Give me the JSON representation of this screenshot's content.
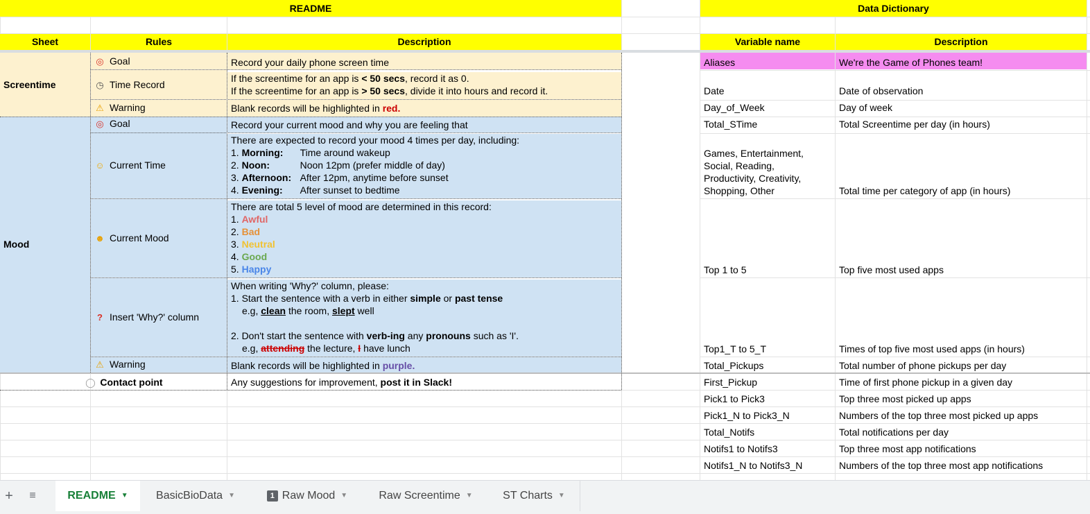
{
  "readme": {
    "title": "README",
    "headers": {
      "sheet": "Sheet",
      "rules": "Rules",
      "description": "Description"
    },
    "screentime": {
      "label": "Screentime",
      "goal": {
        "rule": "Goal",
        "desc": "Record your daily phone screen time"
      },
      "time_record": {
        "rule": "Time Record",
        "line1_a": "If the screentime for an app is ",
        "line1_b": "< 50 secs",
        "line1_c": ", record it as 0.",
        "line2_a": "If the screentime for an app is ",
        "line2_b": "> 50 secs",
        "line2_c": ", divide it into hours and record it."
      },
      "warning": {
        "rule": "Warning",
        "desc_a": "Blank records will be highlighted in ",
        "desc_b": "red."
      }
    },
    "mood": {
      "label": "Mood",
      "goal": {
        "rule": "Goal",
        "desc": "Record your current mood and why you are feeling that"
      },
      "current_time": {
        "rule": "Current Time",
        "intro": "There are expected to record your mood 4 times per day, including:",
        "items": [
          {
            "n": "1. ",
            "name": "Morning:",
            "desc": "Time around wakeup"
          },
          {
            "n": "2. ",
            "name": "Noon:",
            "desc": "Noon 12pm (prefer middle of day)"
          },
          {
            "n": "3. ",
            "name": "Afternoon:",
            "desc": "After 12pm, anytime before sunset"
          },
          {
            "n": "4. ",
            "name": "Evening:",
            "desc": "After sunset to bedtime"
          }
        ]
      },
      "current_mood": {
        "rule": "Current Mood",
        "intro": "There are total 5 level of mood are determined in this record:",
        "levels": [
          "Awful",
          "Bad",
          "Neutral",
          "Good",
          "Happy"
        ],
        "nums": [
          "1. ",
          "2. ",
          "3. ",
          "4. ",
          "5. "
        ]
      },
      "why": {
        "rule": "Insert 'Why?' column",
        "l1": "When writing 'Why?' column, please:",
        "l2_a": "1. Start the sentence with a verb in either ",
        "l2_b": "simple",
        "l2_c": " or ",
        "l2_d": "past tense",
        "l3_a": "e.g, ",
        "l3_b": "clean",
        "l3_c": " the room, ",
        "l3_d": "slept",
        "l3_e": " well",
        "l4_a": "2. Don't start the sentence with ",
        "l4_b": "verb-ing",
        "l4_c": " any ",
        "l4_d": "pronouns",
        "l4_e": " such as 'I'.",
        "l5_a": "e.g, ",
        "l5_b": "attending",
        "l5_c": " the lecture, ",
        "l5_d": "I",
        "l5_e": " have lunch"
      },
      "warning": {
        "rule": "Warning",
        "desc_a": "Blank records will be highlighted in ",
        "desc_b": "purple."
      }
    },
    "contact": {
      "label": "Contact point",
      "desc_a": "Any suggestions for improvement, ",
      "desc_b": "post it in Slack!"
    }
  },
  "dictionary": {
    "title": "Data Dictionary",
    "headers": {
      "variable": "Variable name",
      "description": "Description"
    },
    "rows": [
      {
        "var": "Aliases",
        "desc": "We're the Game of Phones team!"
      },
      {
        "var": "Date",
        "desc": "Date of observation"
      },
      {
        "var": "Day_of_Week",
        "desc": "Day of week"
      },
      {
        "var": "Total_STime",
        "desc": "Total Screentime per day (in hours)"
      },
      {
        "var_lines": [
          "Games, Entertainment,",
          "Social, Reading,",
          "Productivity, Creativity,",
          "Shopping, Other"
        ],
        "desc": "Total time per category of app (in hours)"
      },
      {
        "var": "Top 1 to 5",
        "desc": "Top five most used apps"
      },
      {
        "var": "Top1_T to 5_T",
        "desc": "Times of top five most used apps (in hours)"
      },
      {
        "var": "Total_Pickups",
        "desc": "Total number of phone pickups per day"
      },
      {
        "var": "First_Pickup",
        "desc": "Time of first phone pickup in a given day"
      },
      {
        "var": "Pick1 to Pick3",
        "desc": "Top three most picked up apps"
      },
      {
        "var": "Pick1_N to Pick3_N",
        "desc": "Numbers of the top three most picked up apps"
      },
      {
        "var": "Total_Notifs",
        "desc": "Total notifications per day"
      },
      {
        "var": "Notifs1 to Notifs3",
        "desc": "Top three most app notifications"
      },
      {
        "var": "Notifs1_N to Notifs3_N",
        "desc": "Numbers of the top three most app notifications"
      }
    ]
  },
  "tabs": [
    {
      "label": "README",
      "active": true
    },
    {
      "label": "BasicBioData"
    },
    {
      "label": "Raw Mood",
      "badge": "1"
    },
    {
      "label": "Raw Screentime"
    },
    {
      "label": "ST Charts"
    }
  ],
  "icons": {
    "add": "plus-icon",
    "all_sheets": "menu-icon",
    "goal": "target-icon",
    "time": "clock-icon",
    "warning": "warning-icon",
    "current_time": "sun-icon",
    "current_mood": "smile-icon",
    "why": "question-icon",
    "contact": "speech-bubble-icon"
  },
  "colors": {
    "header": "#ffff00",
    "screentime": "#fdf1cf",
    "mood": "#cfe2f3",
    "aliases": "#f58cf0",
    "active_tab": "#188038"
  }
}
